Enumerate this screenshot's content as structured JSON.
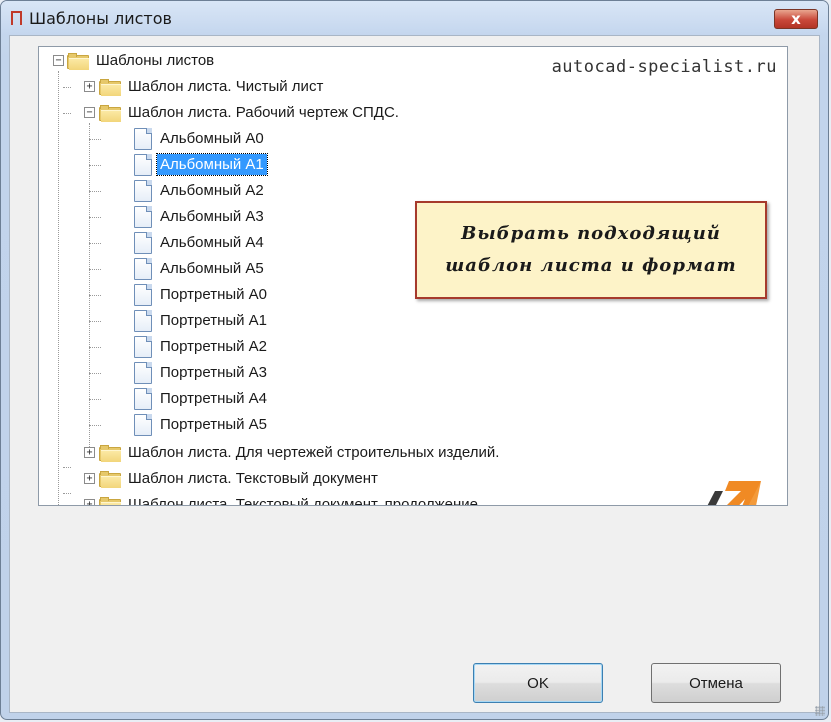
{
  "window": {
    "title": "Шаблоны листов",
    "close_label": "x"
  },
  "tree": {
    "root": {
      "label": "Шаблоны листов",
      "expander": "−"
    },
    "nodes": [
      {
        "label": "Шаблон листа. Чистый лист",
        "expander": "+"
      },
      {
        "label": "Шаблон листа. Рабочий чертеж СПДС.",
        "expander": "−"
      },
      {
        "label": "Шаблон листа. Для чертежей строительных изделий.",
        "expander": "+"
      },
      {
        "label": "Шаблон листа. Текстовый документ",
        "expander": "+"
      },
      {
        "label": "Шаблон листа. Текстовый документ, продолжение",
        "expander": "+"
      }
    ],
    "leaves": [
      {
        "label": "Альбомный A0"
      },
      {
        "label": "Альбомный A1",
        "selected": true
      },
      {
        "label": "Альбомный A2"
      },
      {
        "label": "Альбомный A3"
      },
      {
        "label": "Альбомный A4"
      },
      {
        "label": "Альбомный A5"
      },
      {
        "label": "Портретный A0"
      },
      {
        "label": "Портретный A1"
      },
      {
        "label": "Портретный A2"
      },
      {
        "label": "Портретный A3"
      },
      {
        "label": "Портретный A4"
      },
      {
        "label": "Портретный A5"
      }
    ]
  },
  "overlay": {
    "watermark": "autocad-specialist.ru",
    "callout_line1": "Выбрать подходящий",
    "callout_line2": "шаблон листа и формат"
  },
  "buttons": {
    "ok": "OK",
    "cancel": "Отмена"
  },
  "colors": {
    "selection": "#3399ff",
    "callout_border": "#a63a2c",
    "callout_bg": "#fdf3c8",
    "logo_orange": "#f08a24",
    "logo_dark": "#3a3a3a"
  }
}
